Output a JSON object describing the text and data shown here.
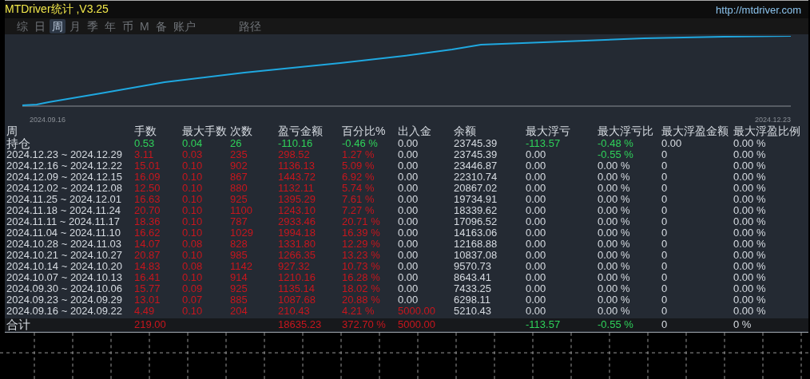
{
  "window": {
    "title": "MTDriver统计 ,V3.25",
    "url": "http://mtdriver.com"
  },
  "tabs": [
    {
      "label": "综",
      "selected": false
    },
    {
      "label": "日",
      "selected": false
    },
    {
      "label": "周",
      "selected": true
    },
    {
      "label": "月",
      "selected": false
    },
    {
      "label": "季",
      "selected": false
    },
    {
      "label": "年",
      "selected": false
    },
    {
      "label": "币",
      "selected": false
    },
    {
      "label": "M",
      "selected": false
    },
    {
      "label": "备",
      "selected": false
    },
    {
      "label": "账户",
      "selected": false
    },
    {
      "label": "路径",
      "selected": false
    }
  ],
  "equity_chart": {
    "start_label": "2024.09.16",
    "end_label": "2024.12.23"
  },
  "table": {
    "columns": [
      "周",
      "手数",
      "最大手数",
      "次数",
      "盈亏金额",
      "百分比%",
      "出入金",
      "余额",
      "最大浮亏",
      "最大浮亏比",
      "最大浮盈金额",
      "最大浮盈比例"
    ],
    "rows": [
      {
        "kind": "open",
        "cells": [
          {
            "text": "持仓"
          },
          {
            "text": "0.53",
            "color": "#2fd25a"
          },
          {
            "text": "0.04",
            "color": "#2fd25a"
          },
          {
            "text": "26",
            "color": "#2fd25a"
          },
          {
            "text": "-110.16",
            "color": "#2fd25a"
          },
          {
            "text": "-0.46 %",
            "color": "#2fd25a"
          },
          {
            "text": "0.00"
          },
          {
            "text": "23745.39"
          },
          {
            "text": "-113.57",
            "color": "#2fd25a"
          },
          {
            "text": "-0.48 %",
            "color": "#2fd25a"
          },
          {
            "text": "0.00"
          },
          {
            "text": "0.00 %"
          }
        ]
      },
      {
        "kind": "week",
        "cells": [
          {
            "text": "2024.12.23 ~ 2024.12.29"
          },
          {
            "text": "3.11",
            "color": "#c8161d"
          },
          {
            "text": "0.03",
            "color": "#c8161d"
          },
          {
            "text": "235",
            "color": "#c8161d"
          },
          {
            "text": "298.52",
            "color": "#c8161d"
          },
          {
            "text": "1.27 %",
            "color": "#c8161d"
          },
          {
            "text": "0.00"
          },
          {
            "text": "23745.39"
          },
          {
            "text": "0.00"
          },
          {
            "text": "-0.55 %",
            "color": "#2fd25a"
          },
          {
            "text": "0"
          },
          {
            "text": "0.00 %"
          }
        ]
      },
      {
        "kind": "week",
        "cells": [
          {
            "text": "2024.12.16 ~ 2024.12.22"
          },
          {
            "text": "15.01",
            "color": "#c8161d"
          },
          {
            "text": "0.10",
            "color": "#c8161d"
          },
          {
            "text": "902",
            "color": "#c8161d"
          },
          {
            "text": "1136.13",
            "color": "#c8161d"
          },
          {
            "text": "5.09 %",
            "color": "#c8161d"
          },
          {
            "text": "0.00"
          },
          {
            "text": "23446.87"
          },
          {
            "text": "0.00"
          },
          {
            "text": "0.00 %"
          },
          {
            "text": "0"
          },
          {
            "text": "0.00 %"
          }
        ]
      },
      {
        "kind": "week",
        "cells": [
          {
            "text": "2024.12.09 ~ 2024.12.15"
          },
          {
            "text": "16.09",
            "color": "#c8161d"
          },
          {
            "text": "0.10",
            "color": "#c8161d"
          },
          {
            "text": "867",
            "color": "#c8161d"
          },
          {
            "text": "1443.72",
            "color": "#c8161d"
          },
          {
            "text": "6.92 %",
            "color": "#c8161d"
          },
          {
            "text": "0.00"
          },
          {
            "text": "22310.74"
          },
          {
            "text": "0.00"
          },
          {
            "text": "0.00 %"
          },
          {
            "text": "0"
          },
          {
            "text": "0.00 %"
          }
        ]
      },
      {
        "kind": "week",
        "cells": [
          {
            "text": "2024.12.02 ~ 2024.12.08"
          },
          {
            "text": "12.50",
            "color": "#c8161d"
          },
          {
            "text": "0.10",
            "color": "#c8161d"
          },
          {
            "text": "880",
            "color": "#c8161d"
          },
          {
            "text": "1132.11",
            "color": "#c8161d"
          },
          {
            "text": "5.74 %",
            "color": "#c8161d"
          },
          {
            "text": "0.00"
          },
          {
            "text": "20867.02"
          },
          {
            "text": "0.00"
          },
          {
            "text": "0.00 %"
          },
          {
            "text": "0"
          },
          {
            "text": "0.00 %"
          }
        ]
      },
      {
        "kind": "week",
        "cells": [
          {
            "text": "2024.11.25 ~ 2024.12.01"
          },
          {
            "text": "16.63",
            "color": "#c8161d"
          },
          {
            "text": "0.10",
            "color": "#c8161d"
          },
          {
            "text": "925",
            "color": "#c8161d"
          },
          {
            "text": "1395.29",
            "color": "#c8161d"
          },
          {
            "text": "7.61 %",
            "color": "#c8161d"
          },
          {
            "text": "0.00"
          },
          {
            "text": "19734.91"
          },
          {
            "text": "0.00"
          },
          {
            "text": "0.00 %"
          },
          {
            "text": "0"
          },
          {
            "text": "0.00 %"
          }
        ]
      },
      {
        "kind": "week",
        "cells": [
          {
            "text": "2024.11.18 ~ 2024.11.24"
          },
          {
            "text": "20.70",
            "color": "#c8161d"
          },
          {
            "text": "0.10",
            "color": "#c8161d"
          },
          {
            "text": "1100",
            "color": "#c8161d"
          },
          {
            "text": "1243.10",
            "color": "#c8161d"
          },
          {
            "text": "7.27 %",
            "color": "#c8161d"
          },
          {
            "text": "0.00"
          },
          {
            "text": "18339.62"
          },
          {
            "text": "0.00"
          },
          {
            "text": "0.00 %"
          },
          {
            "text": "0"
          },
          {
            "text": "0.00 %"
          }
        ]
      },
      {
        "kind": "week",
        "cells": [
          {
            "text": "2024.11.11 ~ 2024.11.17"
          },
          {
            "text": "18.36",
            "color": "#c8161d"
          },
          {
            "text": "0.10",
            "color": "#c8161d"
          },
          {
            "text": "787",
            "color": "#c8161d"
          },
          {
            "text": "2933.46",
            "color": "#c8161d"
          },
          {
            "text": "20.71 %",
            "color": "#c8161d"
          },
          {
            "text": "0.00"
          },
          {
            "text": "17096.52"
          },
          {
            "text": "0.00"
          },
          {
            "text": "0.00 %"
          },
          {
            "text": "0"
          },
          {
            "text": "0.00 %"
          }
        ]
      },
      {
        "kind": "week",
        "cells": [
          {
            "text": "2024.11.04 ~ 2024.11.10"
          },
          {
            "text": "16.62",
            "color": "#c8161d"
          },
          {
            "text": "0.10",
            "color": "#c8161d"
          },
          {
            "text": "1029",
            "color": "#c8161d"
          },
          {
            "text": "1994.18",
            "color": "#c8161d"
          },
          {
            "text": "16.39 %",
            "color": "#c8161d"
          },
          {
            "text": "0.00"
          },
          {
            "text": "14163.06"
          },
          {
            "text": "0.00"
          },
          {
            "text": "0.00 %"
          },
          {
            "text": "0"
          },
          {
            "text": "0.00 %"
          }
        ]
      },
      {
        "kind": "week",
        "cells": [
          {
            "text": "2024.10.28 ~ 2024.11.03"
          },
          {
            "text": "14.07",
            "color": "#c8161d"
          },
          {
            "text": "0.08",
            "color": "#c8161d"
          },
          {
            "text": "828",
            "color": "#c8161d"
          },
          {
            "text": "1331.80",
            "color": "#c8161d"
          },
          {
            "text": "12.29 %",
            "color": "#c8161d"
          },
          {
            "text": "0.00"
          },
          {
            "text": "12168.88"
          },
          {
            "text": "0.00"
          },
          {
            "text": "0.00 %"
          },
          {
            "text": "0"
          },
          {
            "text": "0.00 %"
          }
        ]
      },
      {
        "kind": "week",
        "cells": [
          {
            "text": "2024.10.21 ~ 2024.10.27"
          },
          {
            "text": "20.87",
            "color": "#c8161d"
          },
          {
            "text": "0.10",
            "color": "#c8161d"
          },
          {
            "text": "985",
            "color": "#c8161d"
          },
          {
            "text": "1266.35",
            "color": "#c8161d"
          },
          {
            "text": "13.23 %",
            "color": "#c8161d"
          },
          {
            "text": "0.00"
          },
          {
            "text": "10837.08"
          },
          {
            "text": "0.00"
          },
          {
            "text": "0.00 %"
          },
          {
            "text": "0"
          },
          {
            "text": "0.00 %"
          }
        ]
      },
      {
        "kind": "week",
        "cells": [
          {
            "text": "2024.10.14 ~ 2024.10.20"
          },
          {
            "text": "14.83",
            "color": "#c8161d"
          },
          {
            "text": "0.08",
            "color": "#c8161d"
          },
          {
            "text": "1142",
            "color": "#c8161d"
          },
          {
            "text": "927.32",
            "color": "#c8161d"
          },
          {
            "text": "10.73 %",
            "color": "#c8161d"
          },
          {
            "text": "0.00"
          },
          {
            "text": "9570.73"
          },
          {
            "text": "0.00"
          },
          {
            "text": "0.00 %"
          },
          {
            "text": "0"
          },
          {
            "text": "0.00 %"
          }
        ]
      },
      {
        "kind": "week",
        "cells": [
          {
            "text": "2024.10.07 ~ 2024.10.13"
          },
          {
            "text": "16.41",
            "color": "#c8161d"
          },
          {
            "text": "0.10",
            "color": "#c8161d"
          },
          {
            "text": "914",
            "color": "#c8161d"
          },
          {
            "text": "1210.16",
            "color": "#c8161d"
          },
          {
            "text": "16.28 %",
            "color": "#c8161d"
          },
          {
            "text": "0.00"
          },
          {
            "text": "8643.41"
          },
          {
            "text": "0.00"
          },
          {
            "text": "0.00 %"
          },
          {
            "text": "0"
          },
          {
            "text": "0.00 %"
          }
        ]
      },
      {
        "kind": "week",
        "cells": [
          {
            "text": "2024.09.30 ~ 2024.10.06"
          },
          {
            "text": "15.77",
            "color": "#c8161d"
          },
          {
            "text": "0.09",
            "color": "#c8161d"
          },
          {
            "text": "925",
            "color": "#c8161d"
          },
          {
            "text": "1135.14",
            "color": "#c8161d"
          },
          {
            "text": "18.02 %",
            "color": "#c8161d"
          },
          {
            "text": "0.00"
          },
          {
            "text": "7433.25"
          },
          {
            "text": "0.00"
          },
          {
            "text": "0.00 %"
          },
          {
            "text": "0"
          },
          {
            "text": "0.00 %"
          }
        ]
      },
      {
        "kind": "week",
        "cells": [
          {
            "text": "2024.09.23 ~ 2024.09.29"
          },
          {
            "text": "13.01",
            "color": "#c8161d"
          },
          {
            "text": "0.07",
            "color": "#c8161d"
          },
          {
            "text": "885",
            "color": "#c8161d"
          },
          {
            "text": "1087.68",
            "color": "#c8161d"
          },
          {
            "text": "20.88 %",
            "color": "#c8161d"
          },
          {
            "text": "0.00"
          },
          {
            "text": "6298.11"
          },
          {
            "text": "0.00"
          },
          {
            "text": "0.00 %"
          },
          {
            "text": "0"
          },
          {
            "text": "0.00 %"
          }
        ]
      },
      {
        "kind": "week",
        "cells": [
          {
            "text": "2024.09.16 ~ 2024.09.22"
          },
          {
            "text": "4.49",
            "color": "#c8161d"
          },
          {
            "text": "0.10",
            "color": "#c8161d"
          },
          {
            "text": "204",
            "color": "#c8161d"
          },
          {
            "text": "210.43",
            "color": "#c8161d"
          },
          {
            "text": "4.21 %",
            "color": "#c8161d"
          },
          {
            "text": "5000.00",
            "color": "#c8161d"
          },
          {
            "text": "5210.43"
          },
          {
            "text": "0.00"
          },
          {
            "text": "0.00 %"
          },
          {
            "text": "0"
          },
          {
            "text": "0.00 %"
          }
        ]
      },
      {
        "kind": "total",
        "cells": [
          {
            "text": "合计"
          },
          {
            "text": "219.00",
            "color": "#c8161d"
          },
          null,
          null,
          {
            "text": "18635.23",
            "color": "#c8161d"
          },
          {
            "text": "372.70 %",
            "color": "#c8161d"
          },
          {
            "text": "5000.00",
            "color": "#c8161d"
          },
          null,
          {
            "text": "-113.57",
            "color": "#2fd25a"
          },
          {
            "text": "-0.55 %",
            "color": "#2fd25a"
          },
          {
            "text": "0"
          },
          {
            "text": "0 %"
          }
        ]
      }
    ]
  }
}
